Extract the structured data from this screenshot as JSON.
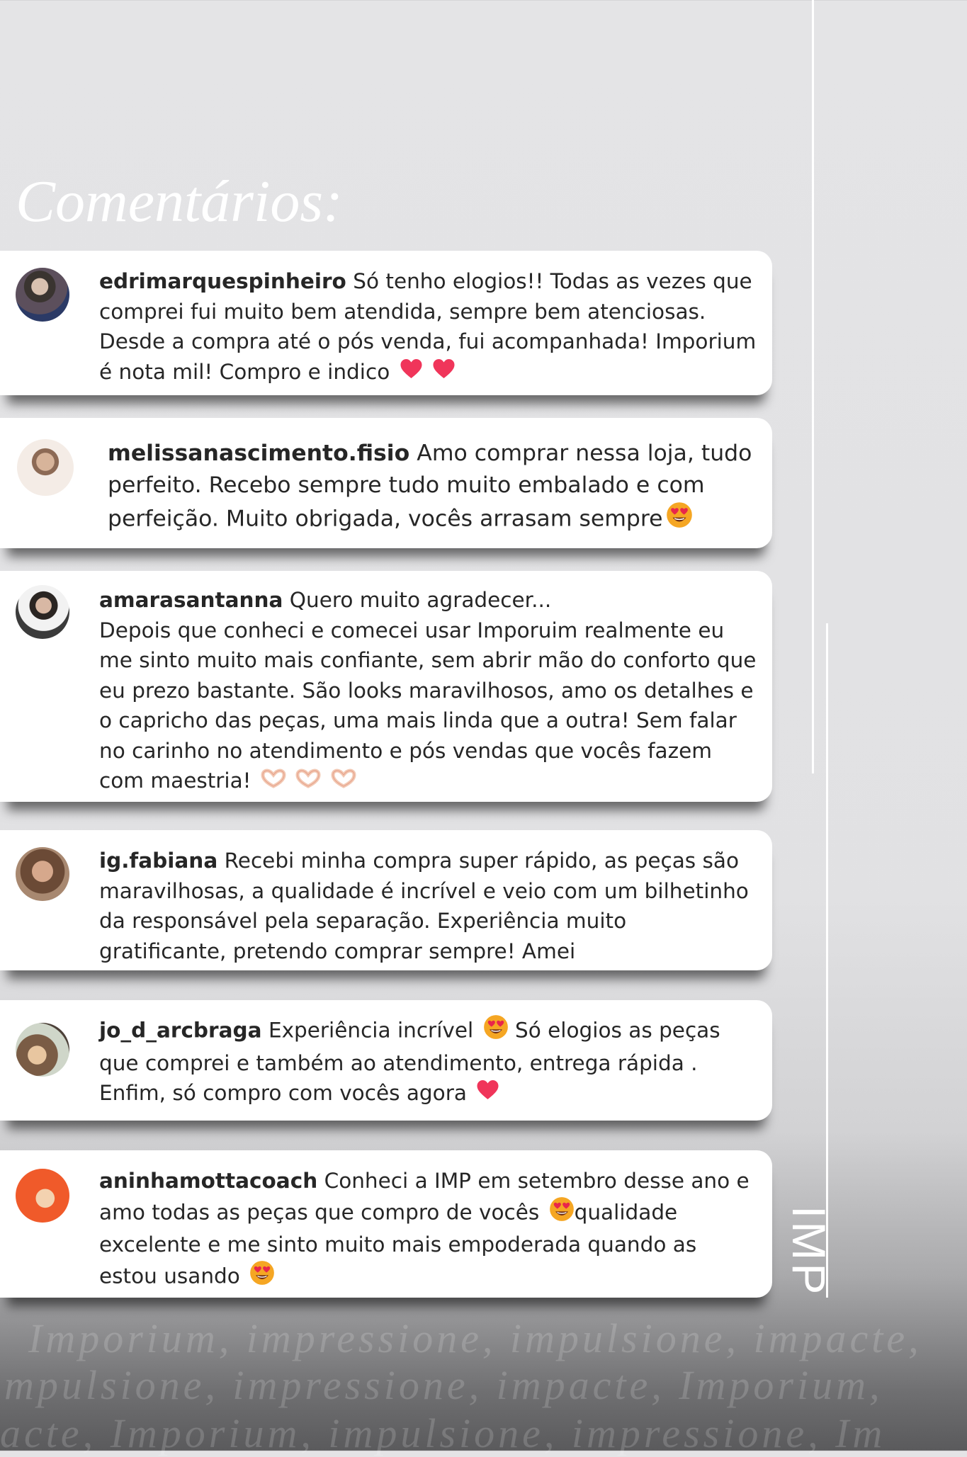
{
  "title": "Comentários:",
  "brand": "IMP",
  "comments": [
    {
      "username": "edrimarquespinheiro",
      "text": "Só tenho elogios!! Todas as vezes que comprei fui muito bem atendida, sempre bem atenciosas. Desde a compra até o pós venda, fui acompanhada! Imporium é nota mil! Compro e indico"
    },
    {
      "username": "melissanascimento.fisio",
      "text": "Amo comprar nessa loja, tudo perfeito. Recebo sempre tudo muito embalado e com perfeição. Muito obrigada, vocês arrasam sempre"
    },
    {
      "username": "amarasantanna",
      "text": "Quero muito agradecer...",
      "text2": "Depois que conheci e comecei usar Imporuim realmente eu me sinto muito mais confiante, sem abrir mão do conforto que eu prezo bastante. São looks maravilhosos, amo os detalhes e o capricho das peças, uma mais linda que a outra! Sem falar no carinho no atendimento e pós vendas que vocês fazem com maestria!"
    },
    {
      "username": "ig.fabiana",
      "text": "Recebi minha compra super rápido, as peças são maravilhosas, a qualidade é incrível e veio com um bilhetinho da responsável pela separação. Experiência muito gratificante, pretendo comprar sempre! Amei"
    },
    {
      "username": "jo_d_arcbraga",
      "text": "Experiência incrível",
      "text2": "Só elogios as peças que comprei e também ao atendimento, entrega rápida . Enfim, só compro com vocês agora"
    },
    {
      "username": "aninhamottacoach",
      "text": "Conheci a IMP em setembro desse ano e amo todas as peças que compro de vocês",
      "text2": "qualidade excelente e me sinto muito mais empoderada quando as estou usando"
    }
  ],
  "taglines": [
    "Imporium, impressione, impulsione, impacte,",
    "mpulsione, impressione, impacte, Imporium,",
    "acte, Imporium, impulsione, impressione, Im"
  ],
  "colors": {
    "background": "#e3e3e5",
    "card": "#ffffff",
    "text": "#262626",
    "heart": "#f0355a",
    "star_eyes_face": "#f5a623"
  },
  "icons": [
    "heart-icon",
    "smiling-face-with-heart-eyes-icon",
    "heart-hands-icon"
  ]
}
